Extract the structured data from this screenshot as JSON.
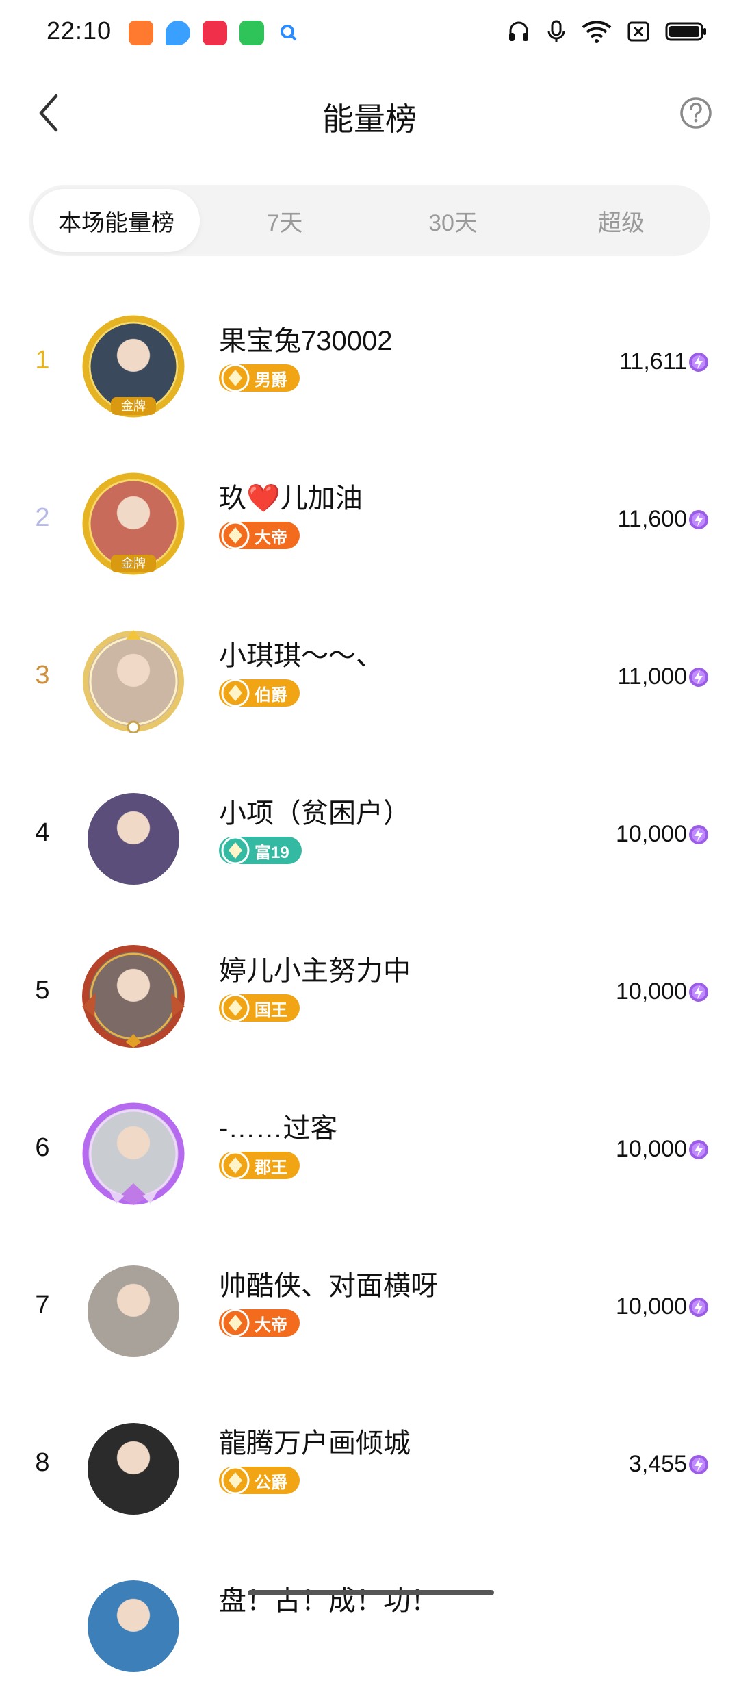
{
  "status_bar": {
    "time": "22:10",
    "app_icons": [
      "video-app-icon",
      "browser-app-icon",
      "video-player-icon",
      "store-app-icon",
      "search-app-icon"
    ],
    "right_icons": [
      "headphones-icon",
      "microphone-icon",
      "wifi-icon",
      "sim-off-icon",
      "battery-icon"
    ]
  },
  "header": {
    "title": "能量榜"
  },
  "tabs": [
    {
      "label": "本场能量榜",
      "active": true
    },
    {
      "label": "7天",
      "active": false
    },
    {
      "label": "30天",
      "active": false
    },
    {
      "label": "超级",
      "active": false
    }
  ],
  "rows": [
    {
      "rank": "1",
      "name": "果宝兔730002",
      "badge": "男爵",
      "score": "11,611",
      "rank_color": "#e7b321",
      "badge_color": "#f2a514",
      "frame": "gold",
      "frame_label": "金牌",
      "avatar_color": "#3a4a5c"
    },
    {
      "rank": "2",
      "name": "玖❤️儿加油",
      "badge": "大帝",
      "score": "11,600",
      "rank_color": "#b7b9e6",
      "badge_color": "#f36b1c",
      "frame": "gold",
      "frame_label": "金牌",
      "avatar_color": "#c96b5a"
    },
    {
      "rank": "3",
      "name": "小琪琪～～、",
      "badge": "伯爵",
      "score": "11,000",
      "rank_color": "#d28f3a",
      "badge_color": "#f2a514",
      "frame": "angel",
      "frame_label": "",
      "avatar_color": "#cbb7a3"
    },
    {
      "rank": "4",
      "name": "小项（贫困户）",
      "badge": "富19",
      "score": "10,000",
      "rank_color": "#111111",
      "badge_color": "#34b9a2",
      "frame": "none",
      "frame_label": "",
      "avatar_color": "#5b4e7a"
    },
    {
      "rank": "5",
      "name": "婷儿小主努力中",
      "badge": "国王",
      "score": "10,000",
      "rank_color": "#111111",
      "badge_color": "#f2a514",
      "frame": "red",
      "frame_label": "",
      "avatar_color": "#7c6a66"
    },
    {
      "rank": "6",
      "name": "-……过客",
      "badge": "郡王",
      "score": "10,000",
      "rank_color": "#111111",
      "badge_color": "#f2a514",
      "frame": "purple",
      "frame_label": "",
      "avatar_color": "#c9cdd1"
    },
    {
      "rank": "7",
      "name": "帅酷侠、对面横呀",
      "badge": "大帝",
      "score": "10,000",
      "rank_color": "#111111",
      "badge_color": "#f36b1c",
      "frame": "none",
      "frame_label": "",
      "avatar_color": "#a9a29b"
    },
    {
      "rank": "8",
      "name": "龍腾万户画倾城",
      "badge": "公爵",
      "score": "3,455",
      "rank_color": "#111111",
      "badge_color": "#f2a514",
      "frame": "none",
      "frame_label": "",
      "avatar_color": "#2b2b2b"
    },
    {
      "rank": "",
      "name": "盘！古！成！功！",
      "badge": "",
      "score": "",
      "rank_color": "#111111",
      "badge_color": "#f2a514",
      "frame": "none",
      "frame_label": "",
      "avatar_color": "#3d7fb8"
    }
  ]
}
